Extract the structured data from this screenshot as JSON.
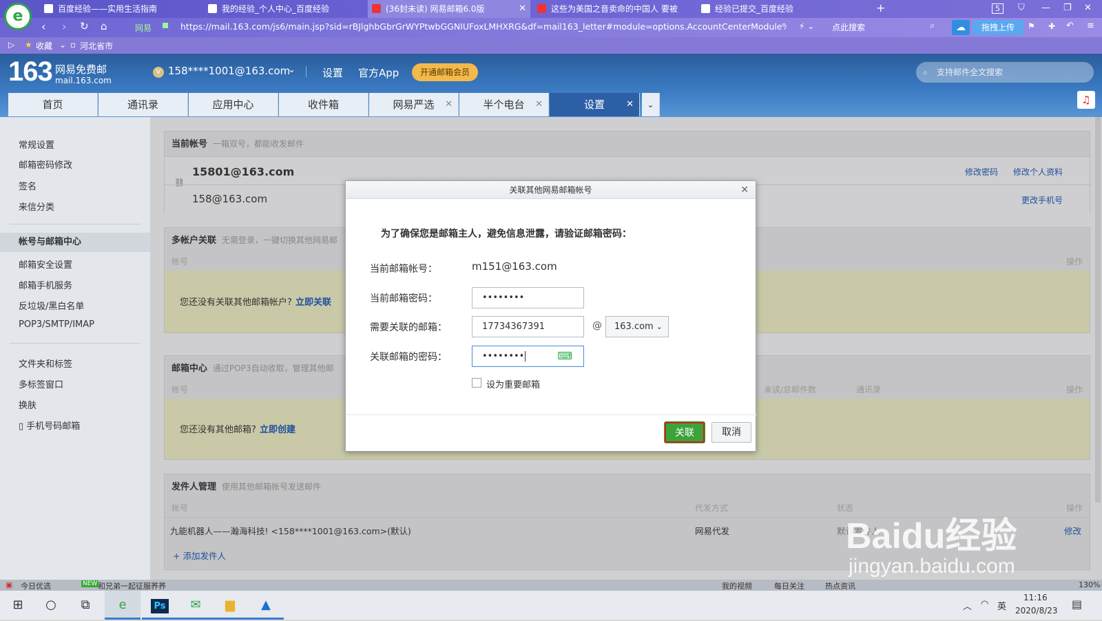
{
  "browser": {
    "tabs": [
      {
        "title": "百度经验——实用生活指南",
        "active": false
      },
      {
        "title": "我的经验_个人中心_百度经验",
        "active": false
      },
      {
        "title": "(36封未读) 网易邮箱6.0版",
        "active": true
      },
      {
        "title": "这些为美国之音卖命的中国人 要被",
        "active": false
      },
      {
        "title": "经验已提交_百度经验",
        "active": false
      }
    ],
    "tab_count": "5",
    "url": "https://mail.163.com/js6/main.jsp?sid=rBJlghbGbrGrWYPtwbGGNIUFoxLMHXRG&df=mail163_letter#module=options.AccountCenterModule%7C",
    "url_site_badge": "网易",
    "search_engine_label": "点此搜索",
    "upload_button": "拖拽上传",
    "bookmarks": [
      "收藏",
      "河北省市"
    ]
  },
  "mail": {
    "logo_number": "163",
    "logo_title": "网易免费邮",
    "logo_domain": "mail.163.com",
    "account": "158****1001@163.com",
    "header_links": [
      "设置",
      "官方App"
    ],
    "vip_button": "开通邮箱会员",
    "search_placeholder": "支持邮件全文搜索",
    "nav_tabs": [
      {
        "label": "首页",
        "closable": false
      },
      {
        "label": "通讯录",
        "closable": false
      },
      {
        "label": "应用中心",
        "closable": false
      },
      {
        "label": "收件箱",
        "closable": false
      },
      {
        "label": "网易严选",
        "closable": true
      },
      {
        "label": "半个电台",
        "closable": true
      },
      {
        "label": "设置",
        "closable": true,
        "active": true
      }
    ]
  },
  "left_menu": {
    "group1": [
      "常规设置",
      "邮箱密码修改",
      "签名",
      "来信分类"
    ],
    "group2": [
      "帐号与邮箱中心",
      "邮箱安全设置",
      "邮箱手机服务",
      "反垃圾/黑白名单",
      "POP3/SMTP/IMAP"
    ],
    "selected": "帐号与邮箱中心",
    "group3": [
      "文件夹和标签",
      "多标签窗口",
      "换肤",
      "手机号码邮箱"
    ]
  },
  "sections": {
    "current_account": {
      "title": "当前帐号",
      "subtitle": "一箱双号，都能收发邮件",
      "primary": "15801@163.com",
      "secondary": "158@163.com",
      "links": [
        "修改密码",
        "修改个人资料"
      ],
      "change_phone": "更改手机号"
    },
    "multi_account": {
      "title": "多帐户关联",
      "subtitle": "无需登录，一键切换其他网易邮",
      "col_account": "帐号",
      "col_action": "操作",
      "empty_text": "您还没有关联其他邮箱帐户?",
      "empty_link": "立即关联"
    },
    "mail_center": {
      "title": "邮箱中心",
      "subtitle": "通过POP3自动收取，管理其他邮",
      "col_account": "帐号",
      "col_unread": "未读/总邮件数",
      "col_contacts": "通讯录",
      "col_action": "操作",
      "empty_text": "您还没有其他邮箱?",
      "empty_link": "立即创建"
    },
    "sender": {
      "title": "发件人管理",
      "subtitle": "使用其他邮箱帐号发送邮件",
      "col_account": "帐号",
      "col_method": "代发方式",
      "col_status": "状态",
      "col_action": "操作",
      "row_account": "九能机器人——瀚海科技! <158****1001@163.com>(默认)",
      "row_method": "网易代发",
      "row_status": "默认发件人",
      "row_action": "修改",
      "add_link": "+ 添加发件人"
    }
  },
  "modal": {
    "title": "关联其他网易邮箱帐号",
    "intro": "为了确保您是邮箱主人，避免信息泄露，请验证邮箱密码：",
    "label_account": "当前邮箱帐号：",
    "account_value": "m151@163.com",
    "label_password": "当前邮箱密码：",
    "password_value": "••••••••",
    "label_link_email": "需要关联的邮箱：",
    "link_email_value": "17734367391",
    "at": "@",
    "domain_select": "163.com",
    "label_link_password": "关联邮箱的密码：",
    "link_password_value": "••••••••",
    "checkbox_label": "设为重要邮箱",
    "confirm_button": "关联",
    "cancel_button": "取消"
  },
  "statusbar": {
    "left": [
      "今日优选",
      "和兄弟一起征服荞荞"
    ],
    "right": [
      "我的视频",
      "每日关注",
      "热点资讯"
    ],
    "zoom": "130%"
  },
  "taskbar": {
    "time": "11:16",
    "date": "2020/8/23",
    "ime": "英"
  },
  "watermark": {
    "text": "Baidu经验",
    "domain": "jingyan.baidu.com"
  }
}
